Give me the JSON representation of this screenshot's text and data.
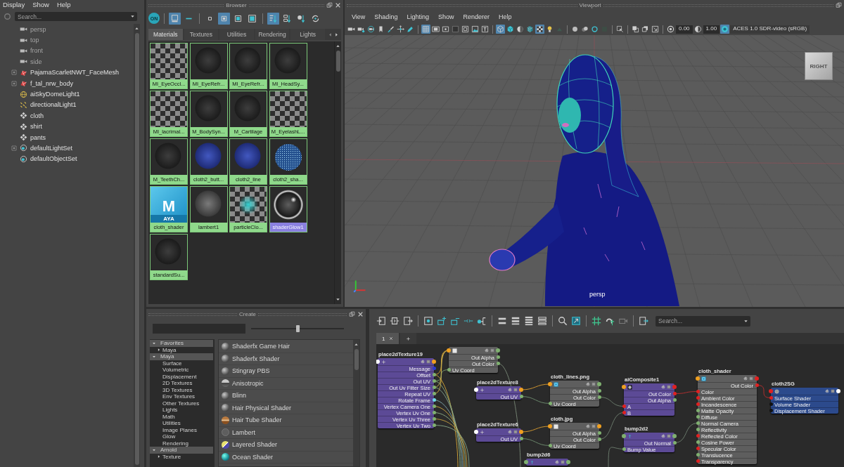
{
  "outliner": {
    "menu": [
      "Display",
      "Show",
      "Help"
    ],
    "search": {
      "placeholder": "Search..."
    },
    "items": [
      {
        "label": "persp",
        "kind": "camera",
        "dimmed": true,
        "expandable": false
      },
      {
        "label": "top",
        "kind": "camera",
        "dimmed": true,
        "expandable": false
      },
      {
        "label": "front",
        "kind": "camera",
        "dimmed": true,
        "expandable": false
      },
      {
        "label": "side",
        "kind": "camera",
        "dimmed": true,
        "expandable": false
      },
      {
        "label": "PajamaScarletNWT_FaceMesh",
        "kind": "mesh",
        "dimmed": false,
        "expandable": true
      },
      {
        "label": "f_tal_nrw_body",
        "kind": "mesh",
        "dimmed": false,
        "expandable": true
      },
      {
        "label": "aiSkyDomeLight1",
        "kind": "sky-light",
        "dimmed": false,
        "expandable": false
      },
      {
        "label": "directionalLight1",
        "kind": "directional-light",
        "dimmed": false,
        "expandable": false
      },
      {
        "label": "cloth",
        "kind": "transform",
        "dimmed": false,
        "expandable": false
      },
      {
        "label": "shirt",
        "kind": "transform",
        "dimmed": false,
        "expandable": false
      },
      {
        "label": "pants",
        "kind": "transform",
        "dimmed": false,
        "expandable": false
      },
      {
        "label": "defaultLightSet",
        "kind": "set",
        "dimmed": false,
        "expandable": true
      },
      {
        "label": "defaultObjectSet",
        "kind": "set",
        "dimmed": false,
        "expandable": false
      }
    ]
  },
  "browser": {
    "title": "Browser",
    "toolbar": [
      [
        {
          "kind": "toggle",
          "label": "ON",
          "on": false
        }
      ],
      [
        {
          "kind": "tile-view",
          "on": true
        },
        {
          "kind": "shelf",
          "on": false
        }
      ],
      [
        {
          "kind": "tiny-square",
          "on": false
        },
        {
          "kind": "small-square",
          "on": true
        },
        {
          "kind": "medium-square",
          "on": false
        },
        {
          "kind": "large-square",
          "on": false
        }
      ],
      [
        {
          "kind": "sort-name",
          "on": true
        },
        {
          "kind": "sort-type",
          "on": false
        },
        {
          "kind": "sort-time",
          "on": false
        },
        {
          "kind": "refresh",
          "on": false
        }
      ]
    ],
    "tabs": [
      {
        "label": "Materials",
        "selected": true
      },
      {
        "label": "Textures",
        "selected": false
      },
      {
        "label": "Utilities",
        "selected": false
      },
      {
        "label": "Rendering",
        "selected": false
      },
      {
        "label": "Lights",
        "selected": false
      }
    ],
    "materials": [
      {
        "label": "MI_EyeOccl...",
        "kind": "checker",
        "selected": false
      },
      {
        "label": "MI_EyeRefr...",
        "kind": "sphere",
        "selected": false
      },
      {
        "label": "MI_EyeRefr...",
        "kind": "sphere",
        "selected": false
      },
      {
        "label": "MI_HeadSy...",
        "kind": "sphere",
        "selected": false
      },
      {
        "label": "MI_lacrimal...",
        "kind": "checker",
        "selected": false
      },
      {
        "label": "M_BodySyn...",
        "kind": "sphere",
        "selected": false
      },
      {
        "label": "M_Cartilage",
        "kind": "sphere",
        "selected": false
      },
      {
        "label": "M_EyelashL...",
        "kind": "checker",
        "selected": false
      },
      {
        "label": "M_TeethCh...",
        "kind": "sphere",
        "selected": false
      },
      {
        "label": "cloth2_butt...",
        "kind": "blue-sphere",
        "selected": false
      },
      {
        "label": "cloth2_line",
        "kind": "blue-sphere",
        "selected": false
      },
      {
        "label": "cloth2_sha...",
        "kind": "speckled-sphere",
        "selected": false
      },
      {
        "label": "cloth_shader",
        "kind": "logo",
        "logo": "M",
        "logo_caption": "AYA",
        "selected": false
      },
      {
        "label": "lambert1",
        "kind": "gray-sphere",
        "selected": false
      },
      {
        "label": "particleClo...",
        "kind": "checker-glow",
        "selected": false
      },
      {
        "label": "shaderGlow1",
        "kind": "glow-sphere",
        "selected": true
      },
      {
        "label": "standardSu...",
        "kind": "sphere",
        "selected": false
      }
    ]
  },
  "viewport": {
    "title": "Viewport",
    "menu": [
      "View",
      "Shading",
      "Lighting",
      "Show",
      "Renderer",
      "Help"
    ],
    "toolbar": [
      [
        {
          "kind": "camera",
          "on": false
        },
        {
          "kind": "camera-lock",
          "on": false
        },
        {
          "kind": "camera-orbit",
          "on": false
        },
        {
          "kind": "bookmark",
          "on": false
        },
        {
          "kind": "paint-brush",
          "on": false
        },
        {
          "kind": "move-arrows",
          "on": false
        },
        {
          "kind": "pencil",
          "on": false
        }
      ],
      [
        {
          "kind": "grid",
          "on": true
        },
        {
          "kind": "film-gate",
          "on": false
        },
        {
          "kind": "resolution-gate",
          "on": false
        },
        {
          "kind": "blank-square",
          "on": false
        },
        {
          "kind": "safe-frame",
          "on": false
        },
        {
          "kind": "image-plane",
          "on": false
        },
        {
          "kind": "text-tool",
          "on": false
        }
      ],
      [
        {
          "kind": "wireframe-cube",
          "on": true
        },
        {
          "kind": "solid-cube",
          "on": false
        },
        {
          "kind": "shaded-ball",
          "on": false
        },
        {
          "kind": "textured-cube",
          "on": false
        },
        {
          "kind": "checker",
          "on": true
        },
        {
          "kind": "light-bulb",
          "on": false
        },
        {
          "kind": "shadow",
          "on": false
        }
      ],
      [
        {
          "kind": "sphere",
          "on": false
        },
        {
          "kind": "sphere-pair",
          "on": false
        },
        {
          "kind": "ring",
          "on": false
        },
        {
          "kind": "square",
          "on": false
        }
      ],
      [
        {
          "kind": "select-arrow",
          "on": false
        }
      ],
      [
        {
          "kind": "overlap-squares",
          "on": false
        },
        {
          "kind": "stacked-squares",
          "on": false
        },
        {
          "kind": "square-arrow",
          "on": false
        }
      ],
      [
        {
          "kind": "aperture",
          "on": false
        },
        {
          "kind": "field",
          "value": "0.00",
          "on": false
        },
        {
          "kind": "half-circle",
          "on": false
        },
        {
          "kind": "field",
          "value": "1.00",
          "on": false
        },
        {
          "kind": "color-circle",
          "on": true
        },
        {
          "kind": "dropdown",
          "value": "ACES 1.0 SDR-video (sRGB)",
          "on": false
        }
      ]
    ],
    "camera_label": "persp",
    "view_cube_label": "RIGHT"
  },
  "create": {
    "title": "Create",
    "slider": {
      "level": 0.5
    },
    "categories": [
      {
        "label": "Favorites",
        "expanded": true,
        "children": [
          {
            "label": "Maya",
            "expanded": false
          }
        ]
      },
      {
        "label": "Maya",
        "expanded": true,
        "children": [
          {
            "label": "Surface"
          },
          {
            "label": "Volumetric"
          },
          {
            "label": "Displacement"
          },
          {
            "label": "2D Textures"
          },
          {
            "label": "3D Textures"
          },
          {
            "label": "Env Textures"
          },
          {
            "label": "Other Textures"
          },
          {
            "label": "Lights"
          },
          {
            "label": "Math"
          },
          {
            "label": "Utilities"
          },
          {
            "label": "Image Planes"
          },
          {
            "label": "Glow"
          },
          {
            "label": "Rendering"
          }
        ]
      },
      {
        "label": "Arnold",
        "expanded": true,
        "children": [
          {
            "label": "Texture",
            "expanded": false
          }
        ]
      }
    ],
    "items": [
      {
        "label": "Shaderfx Game Hair",
        "kind": "sphere"
      },
      {
        "label": "Shaderfx Shader",
        "kind": "sphere"
      },
      {
        "label": "Stingray PBS",
        "kind": "sphere"
      },
      {
        "label": "Anisotropic",
        "kind": "half-sphere"
      },
      {
        "label": "Blinn",
        "kind": "sphere"
      },
      {
        "label": "Hair Physical Shader",
        "kind": "sphere"
      },
      {
        "label": "Hair Tube Shader",
        "kind": "striped-sphere"
      },
      {
        "label": "Lambert",
        "kind": "flat-sphere"
      },
      {
        "label": "Layered Shader",
        "kind": "split-sphere"
      },
      {
        "label": "Ocean Shader",
        "kind": "glossy-sphere"
      }
    ]
  },
  "node_editor": {
    "toolbar": [
      [
        {
          "kind": "input-connections",
          "on": false
        },
        {
          "kind": "input-output-connections",
          "on": false
        },
        {
          "kind": "output-connections",
          "on": false
        }
      ],
      [
        {
          "kind": "frame-all",
          "on": false
        },
        {
          "kind": "graph-add",
          "on": false
        },
        {
          "kind": "graph-remove",
          "on": false
        },
        {
          "kind": "graph-clear",
          "on": false
        },
        {
          "kind": "node-connect",
          "on": false
        }
      ],
      [
        {
          "kind": "list-simple",
          "on": false
        },
        {
          "kind": "list-connected",
          "on": false
        },
        {
          "kind": "list-full",
          "on": false
        },
        {
          "kind": "list-custom",
          "on": false
        }
      ],
      [
        {
          "kind": "search",
          "on": false
        },
        {
          "kind": "framed-square",
          "on": false
        }
      ],
      [
        {
          "kind": "grid-snap",
          "on": false
        },
        {
          "kind": "magnet-grid",
          "on": false
        },
        {
          "kind": "camera-frame",
          "on": false
        }
      ],
      [
        {
          "kind": "frame-arrow",
          "on": false
        }
      ]
    ],
    "search": {
      "placeholder": "Search..."
    },
    "tabs": [
      {
        "label": "1",
        "selected": true
      }
    ],
    "nodes": [
      {
        "title": "place2dTexture19",
        "kind": "place2d",
        "color": "#5c4a96",
        "ports": [
          {
            "kind": "input",
            "color": "#ffffff"
          },
          {
            "kind": "output",
            "color": "#f0a020"
          }
        ],
        "attributes": [
          {
            "label": "Message",
            "kind": "output",
            "color": "#2a3ad0"
          },
          {
            "label": "Offset",
            "kind": "output",
            "color": "#7fb070"
          },
          {
            "label": "Out UV",
            "kind": "output",
            "color": "#7fb070"
          },
          {
            "label": "Out Uv Filter Size",
            "kind": "output",
            "color": "#7fb070"
          },
          {
            "label": "Repeat UV",
            "kind": "output",
            "color": "#7fb070"
          },
          {
            "label": "Rotate Frame",
            "kind": "output",
            "color": "#6fd8e8"
          },
          {
            "label": "Vertex Camera One",
            "kind": "output",
            "color": "#7fb070"
          },
          {
            "label": "Vertex Uv One",
            "kind": "output",
            "color": "#7fb070"
          },
          {
            "label": "Vertex Uv Three",
            "kind": "output",
            "color": "#7fb070"
          },
          {
            "label": "Vertex Uv Two",
            "kind": "output",
            "color": "#7fb070"
          }
        ]
      },
      {
        "kind": "file",
        "color": "#5e5e5e",
        "ports": [
          {
            "kind": "input",
            "color": "#f0a020"
          },
          {
            "kind": "output",
            "color": "#7fb070"
          }
        ],
        "attributes": [
          {
            "label": "Out Alpha",
            "kind": "output",
            "color": "#7fb070"
          },
          {
            "label": "Out Color",
            "kind": "output",
            "color": "#7fb070"
          },
          {
            "label": "Uv Coord",
            "kind": "input",
            "color": "#7fb070"
          }
        ]
      },
      {
        "title": "place2dTexture8",
        "kind": "place2d",
        "color": "#5c4a96",
        "ports": [
          {
            "kind": "input",
            "color": "#ffffff"
          },
          {
            "kind": "output",
            "color": "#f0a020"
          }
        ],
        "attributes": [
          {
            "label": "Out UV",
            "kind": "output",
            "color": "#7fb070"
          }
        ]
      },
      {
        "title": "cloth_lines.png",
        "kind": "app-file",
        "color": "#5e5e5e",
        "ports": [
          {
            "kind": "input",
            "color": "#f0a020"
          },
          {
            "kind": "output",
            "color": "#7fb070"
          }
        ],
        "attributes": [
          {
            "label": "Out Alpha",
            "kind": "output",
            "color": "#7fb070"
          },
          {
            "label": "Out Color",
            "kind": "output",
            "color": "#7fb070"
          },
          {
            "label": "Uv Coord",
            "kind": "input",
            "color": "#7fb070"
          }
        ]
      },
      {
        "title": "place2dTexture6",
        "kind": "place2d",
        "color": "#5c4a96",
        "ports": [
          {
            "kind": "input",
            "color": "#ffffff"
          },
          {
            "kind": "output",
            "color": "#f0a020"
          }
        ],
        "attributes": [
          {
            "label": "Out UV",
            "kind": "output",
            "color": "#7fb070"
          }
        ]
      },
      {
        "title": "cloth.jpg",
        "kind": "file",
        "color": "#5e5e5e",
        "ports": [
          {
            "kind": "input",
            "color": "#f0a020"
          },
          {
            "kind": "output",
            "color": "#f0a020"
          }
        ],
        "attributes": [
          {
            "label": "Out Alpha",
            "kind": "output",
            "color": "#7fb070"
          },
          {
            "label": "Out Color",
            "kind": "output",
            "color": "#7fb070"
          },
          {
            "label": "Uv Coord",
            "kind": "input",
            "color": "#7fb070"
          }
        ]
      },
      {
        "title": "bump2d6",
        "kind": "bump",
        "color": "#5c4a96",
        "ports": [
          {
            "kind": "input",
            "color": "#7fb070"
          },
          {
            "kind": "output",
            "color": "#7fb070"
          }
        ]
      },
      {
        "title": "aiComposite1",
        "kind": "composite",
        "color": "#5c4a96",
        "ports": [
          {
            "kind": "input",
            "color": "#f0a020"
          },
          {
            "kind": "output",
            "color": "#e02020"
          }
        ],
        "attributes": [
          {
            "label": "Out Color",
            "kind": "output",
            "color": "#e02020"
          },
          {
            "label": "Out Alpha",
            "kind": "output",
            "color": "#7fb070"
          },
          {
            "label": "A",
            "kind": "input",
            "color": "#e02020"
          },
          {
            "label": "B",
            "kind": "input",
            "color": "#e02020"
          }
        ]
      },
      {
        "title": "bump2d2",
        "kind": "bump",
        "color": "#5c4a96",
        "ports": [
          {
            "kind": "input",
            "color": "#7fb070"
          },
          {
            "kind": "output",
            "color": "#7fb070"
          }
        ],
        "attributes": [
          {
            "label": "Out Normal",
            "kind": "output",
            "color": "#7fb070"
          },
          {
            "label": "Bump Value",
            "kind": "input",
            "color": "#7fb070"
          }
        ]
      },
      {
        "title": "cloth_shader",
        "kind": "shader",
        "color": "#5e5e5e",
        "ports": [
          {
            "kind": "input",
            "color": "#f0a020"
          },
          {
            "kind": "output",
            "color": "#e02020"
          }
        ],
        "attributes": [
          {
            "label": "Out Color",
            "kind": "output",
            "color": "#e02020"
          },
          {
            "label": "Color",
            "kind": "input",
            "color": "#e02020"
          },
          {
            "label": "Ambient Color",
            "kind": "input",
            "color": "#e02020"
          },
          {
            "label": "Incandescence",
            "kind": "input",
            "color": "#e02020"
          },
          {
            "label": "Matte Opacity",
            "kind": "input",
            "color": "#7fb070"
          },
          {
            "label": "Diffuse",
            "kind": "input",
            "color": "#7fb070"
          },
          {
            "label": "Normal Camera",
            "kind": "input",
            "color": "#7fb070"
          },
          {
            "label": "Reflectivity",
            "kind": "input",
            "color": "#7fb070"
          },
          {
            "label": "Reflected Color",
            "kind": "input",
            "color": "#e02020"
          },
          {
            "label": "Cosine Power",
            "kind": "input",
            "color": "#7fb070"
          },
          {
            "label": "Specular Color",
            "kind": "input",
            "color": "#e02020"
          },
          {
            "label": "Translucence",
            "kind": "input",
            "color": "#7fb070"
          },
          {
            "label": "Transparency",
            "kind": "input",
            "color": "#e02020"
          }
        ]
      },
      {
        "title": "cloth2SG",
        "kind": "shading-group",
        "color": "#2c4a8c",
        "ports": [
          {
            "kind": "input",
            "color": "#e02020"
          },
          {
            "kind": "output",
            "color": "#ffffff"
          }
        ],
        "attributes": [
          {
            "label": "Surface Shader",
            "kind": "input",
            "color": "#e02020"
          },
          {
            "label": "Volume Shader",
            "kind": "input",
            "color": "#111111"
          },
          {
            "label": "Displacement Shader",
            "kind": "input",
            "color": "#111111"
          }
        ]
      }
    ]
  }
}
